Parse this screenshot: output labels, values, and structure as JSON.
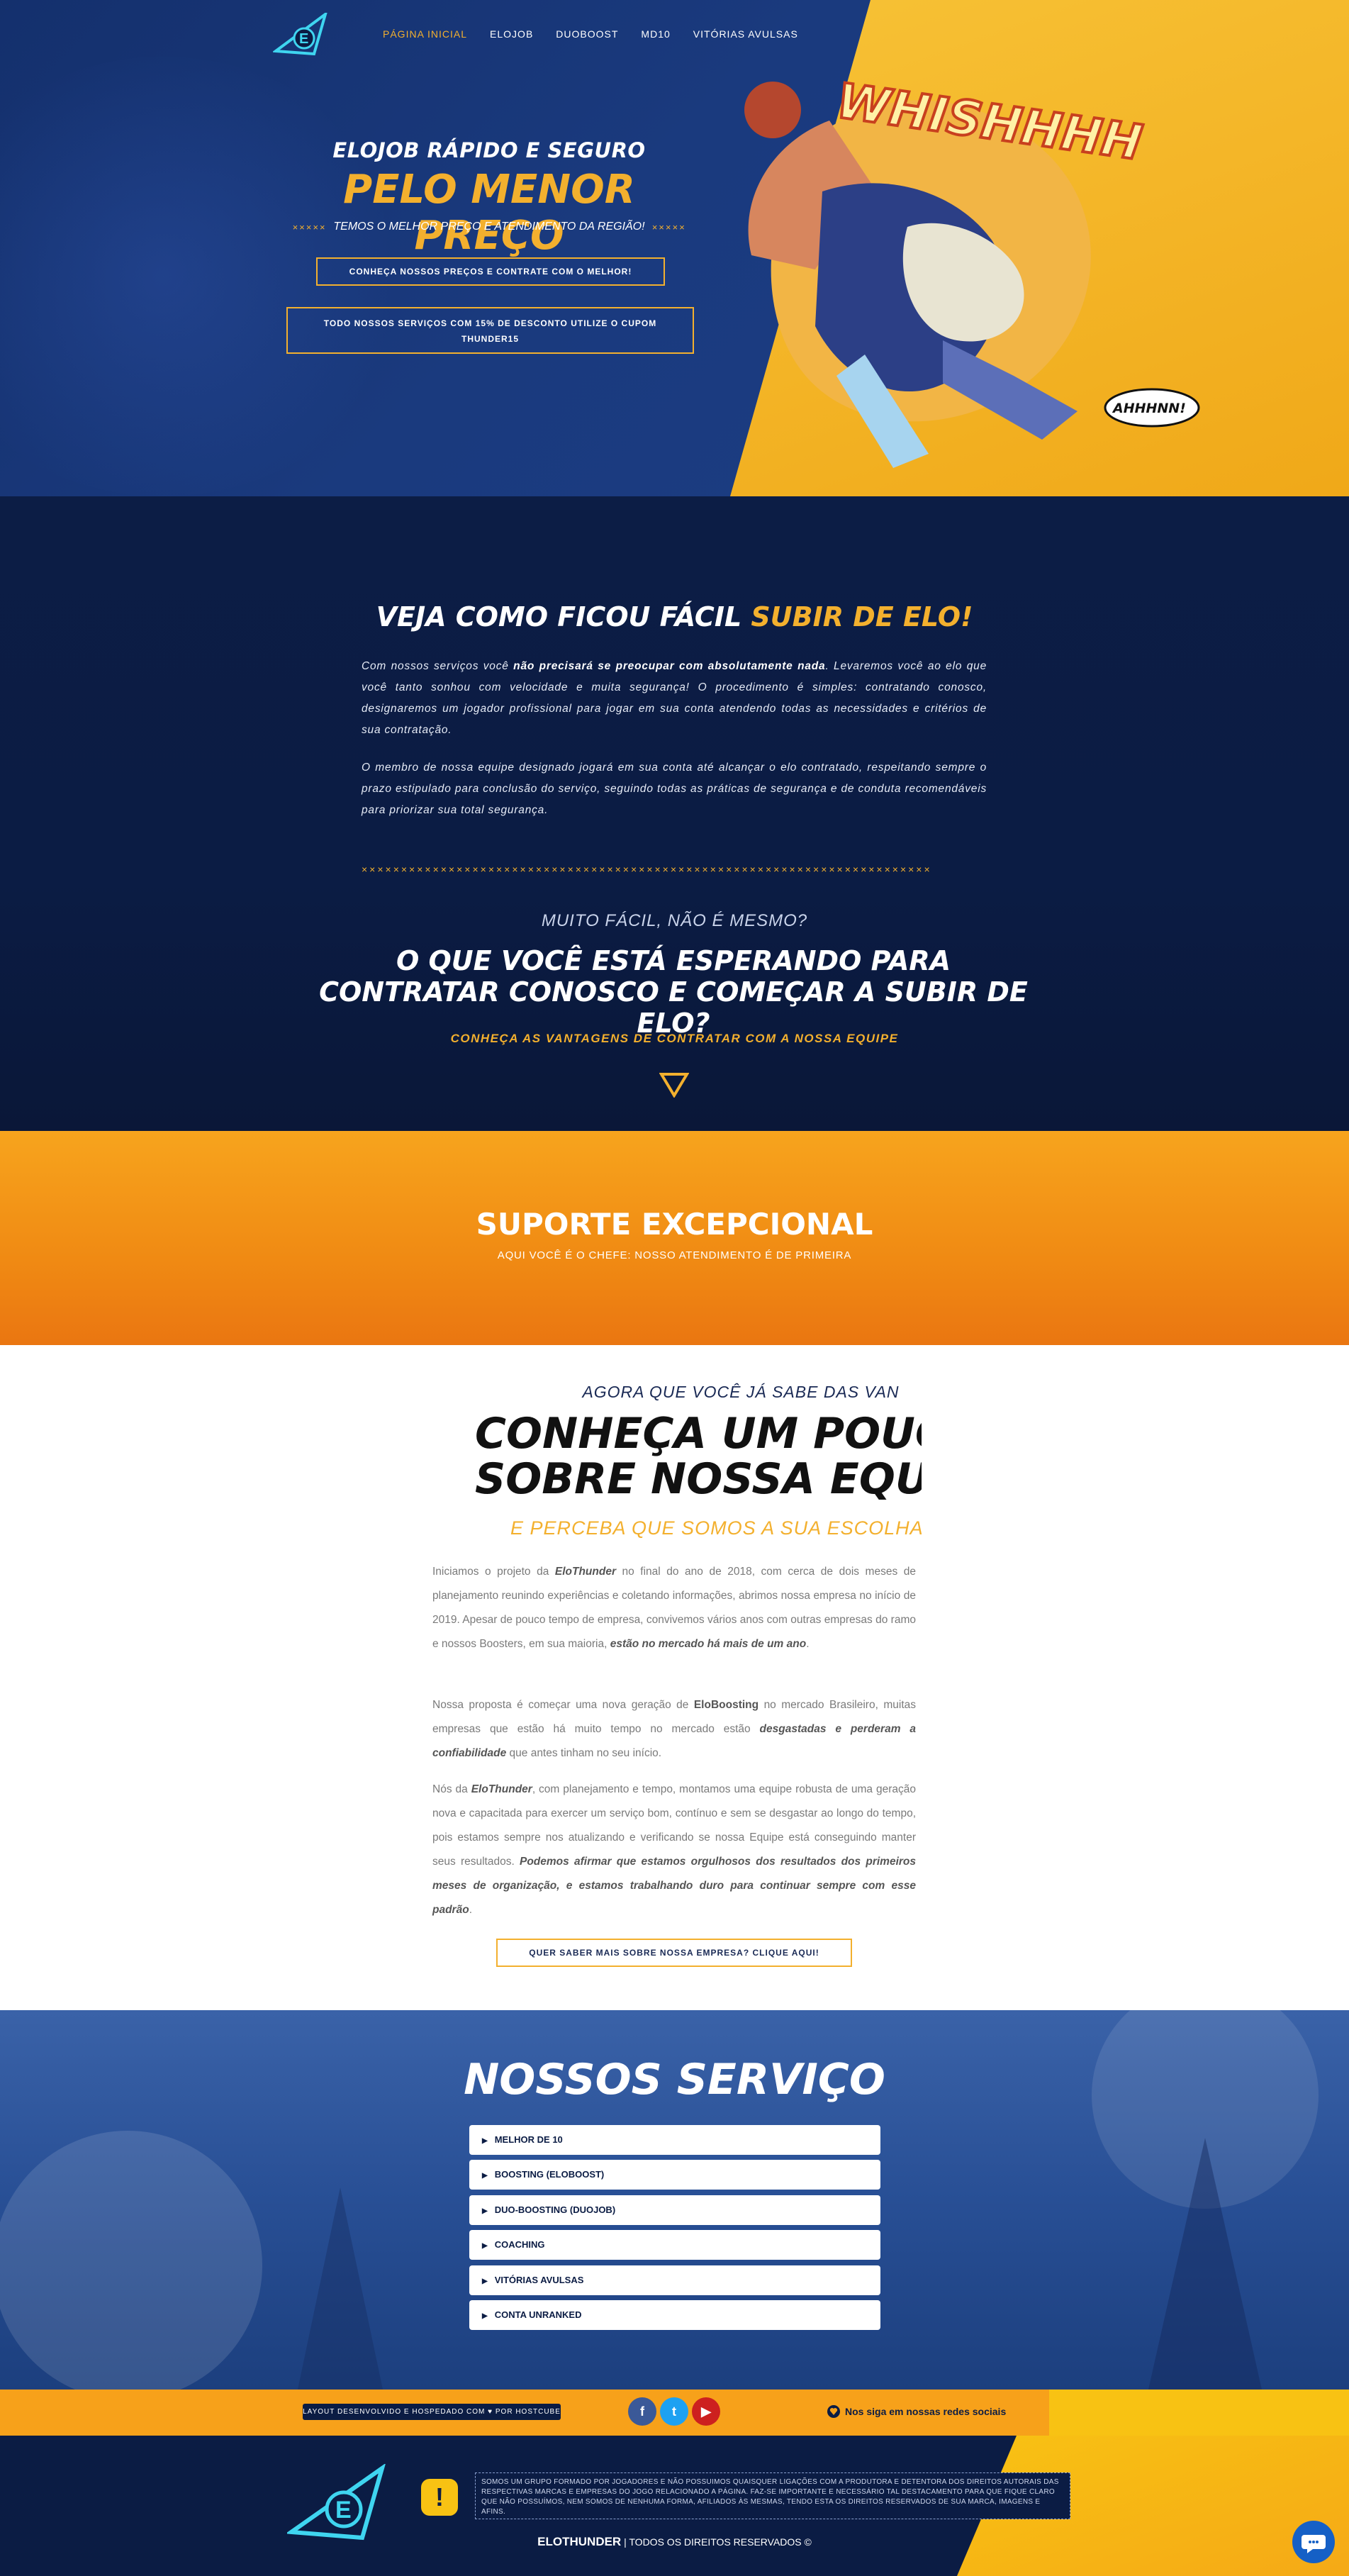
{
  "colors": {
    "accent": "#f3b02e",
    "navy": "#0b1c44",
    "orange": "#f08a13",
    "hero_blue": "#1a3a7e"
  },
  "nav": {
    "items": [
      "PÁGINA INICIAL",
      "ELOJOB",
      "DUOBOOST",
      "MD10",
      "VITÓRIAS AVULSAS"
    ]
  },
  "hero": {
    "tagline": "ELOJOB RÁPIDO E SEGURO",
    "title": "PELO MENOR PREÇO",
    "subtitle": "TEMOS O MELHOR PREÇO E ATENDIMENTO DA REGIÃO!",
    "xs": "××××× ",
    "cta": "CONHEÇA NOSSOS PREÇOS E CONTRATE COM O MELHOR!",
    "coupon": "TODO NOSSOS SERVIÇOS COM 15% DE DESCONTO UTILIZE O CUPOM THUNDER15",
    "art_text1": "WHISHHHH",
    "art_text2": "AHHHNN!"
  },
  "intro": {
    "title_white": "VEJA COMO FICOU FÁCIL ",
    "title_yellow": "SUBIR DE ELO!",
    "p1_a": "Com nossos serviços você ",
    "p1_b": "não precisará se preocupar com absolutamente nada",
    "p1_c": ". Levaremos você ao elo que você tanto sonhou com velocidade e muita segurança! O procedimento é simples: contratando conosco, designaremos um jogador profissional para jogar em sua conta atendendo todas as necessidades e critérios de sua contratação.",
    "p2": "O membro de nossa equipe designado jogará em sua conta até alcançar o elo contratado, respeitando sempre o prazo estipulado para conclusão do serviço, seguindo todas as práticas de segurança e de conduta recomendáveis para priorizar sua total segurança.",
    "xline": "××××××××××××××××××××××××××××××××××××××××××××××××××××××××××××××××××××××××",
    "easy": "MUITO FÁCIL, NÃO É MESMO?",
    "question": "O QUE VOCÊ ESTÁ ESPERANDO PARA CONTRATAR CONOSCO E COMEÇAR A SUBIR DE ELO?",
    "advantages": "CONHEÇA AS VANTAGENS DE CONTRATAR COM A NOSSA EQUIPE"
  },
  "support": {
    "title": "SUPORTE EXCEPCIONAL",
    "subtitle": "AQUI VOCÊ É O CHEFE: NOSSO ATENDIMENTO É DE PRIMEIRA"
  },
  "team": {
    "pre": "AGORA QUE VOCÊ JÁ SABE DAS VAN",
    "title1": "CONHEÇA UM POUCO",
    "title2": "SOBRE NOSSA EQUIP",
    "sub": "E PERCEBA QUE SOMOS A SUA ESCOLHA CERT",
    "p1_a": "Iniciamos o projeto da ",
    "p1_b": "EloThunder",
    "p1_c": " no final do ano de 2018, com cerca de dois meses de planejamento reunindo experiências e coletando informações, abrimos nossa empresa no início de 2019. Apesar de pouco tempo de empresa, convivemos vários anos com outras empresas do ramo e nossos Boosters, em sua maioria, ",
    "p1_d": "estão no mercado há mais de um ano",
    "p1_e": ".",
    "p2_a": "Nossa proposta é começar uma nova geração de ",
    "p2_b": "EloBoosting",
    "p2_c": " no mercado Brasileiro, muitas empresas que estão há muito tempo no mercado estão ",
    "p2_d": "desgastadas e perderam a confiabilidade",
    "p2_e": " que antes tinham no seu início.",
    "p3_a": "Nós da ",
    "p3_b": "EloThunder",
    "p3_c": ", com planejamento e tempo, montamos uma equipe robusta de uma geração nova e capacitada para exercer um serviço bom, contínuo e sem se desgastar ao longo do tempo, pois estamos sempre nos atualizando e verificando se nossa Equipe está conseguindo manter seus resultados. ",
    "p3_d": "Podemos afirmar que estamos orgulhosos dos resultados dos primeiros meses de organização, e estamos trabalhando duro para continuar sempre com esse padrão",
    "p3_e": ".",
    "cta": "QUER SABER MAIS SOBRE NOSSA EMPRESA? CLIQUE AQUI!"
  },
  "services": {
    "title": "NOSSOS SERVIÇO",
    "items": [
      "MELHOR DE 10",
      "BOOSTING (ELOBOOST)",
      "DUO-BOOSTING (DUOJOB)",
      "COACHING",
      "VITÓRIAS AVULSAS",
      "CONTA UNRANKED"
    ]
  },
  "bar": {
    "credit": "LAYOUT DESENVOLVIDO E HOSPEDADO COM ♥ POR HOSTCUBE",
    "follow": "Nos siga em nossas redes sociais",
    "social": [
      "facebook-icon",
      "twitter-icon",
      "youtube-icon"
    ]
  },
  "footer": {
    "legal": "SOMOS UM GRUPO FORMADO POR JOGADORES E NÃO POSSUIMOS QUAISQUER LIGAÇÕES COM A PRODUTORA E DETENTORA DOS DIREITOS AUTORAIS DAS RESPECTIVAS MARCAS E EMPRESAS DO JOGO RELACIONADO A PÁGINA. FAZ-SE IMPORTANTE E NECESSÁRIO TAL DESTACAMENTO PARA QUE FIQUE CLARO QUE NÃO POSSUÍMOS, NEM SOMOS DE NENHUMA FORMA, AFILIADOS ÀS MESMAS, TENDO ESTA OS DIREITOS RESERVADOS DE SUA MARCA, IMAGENS E AFINS.",
    "brand": "ELOTHUNDER",
    "rights": " | TODOS OS DIREITOS RESERVADOS ©",
    "warn": "!"
  }
}
